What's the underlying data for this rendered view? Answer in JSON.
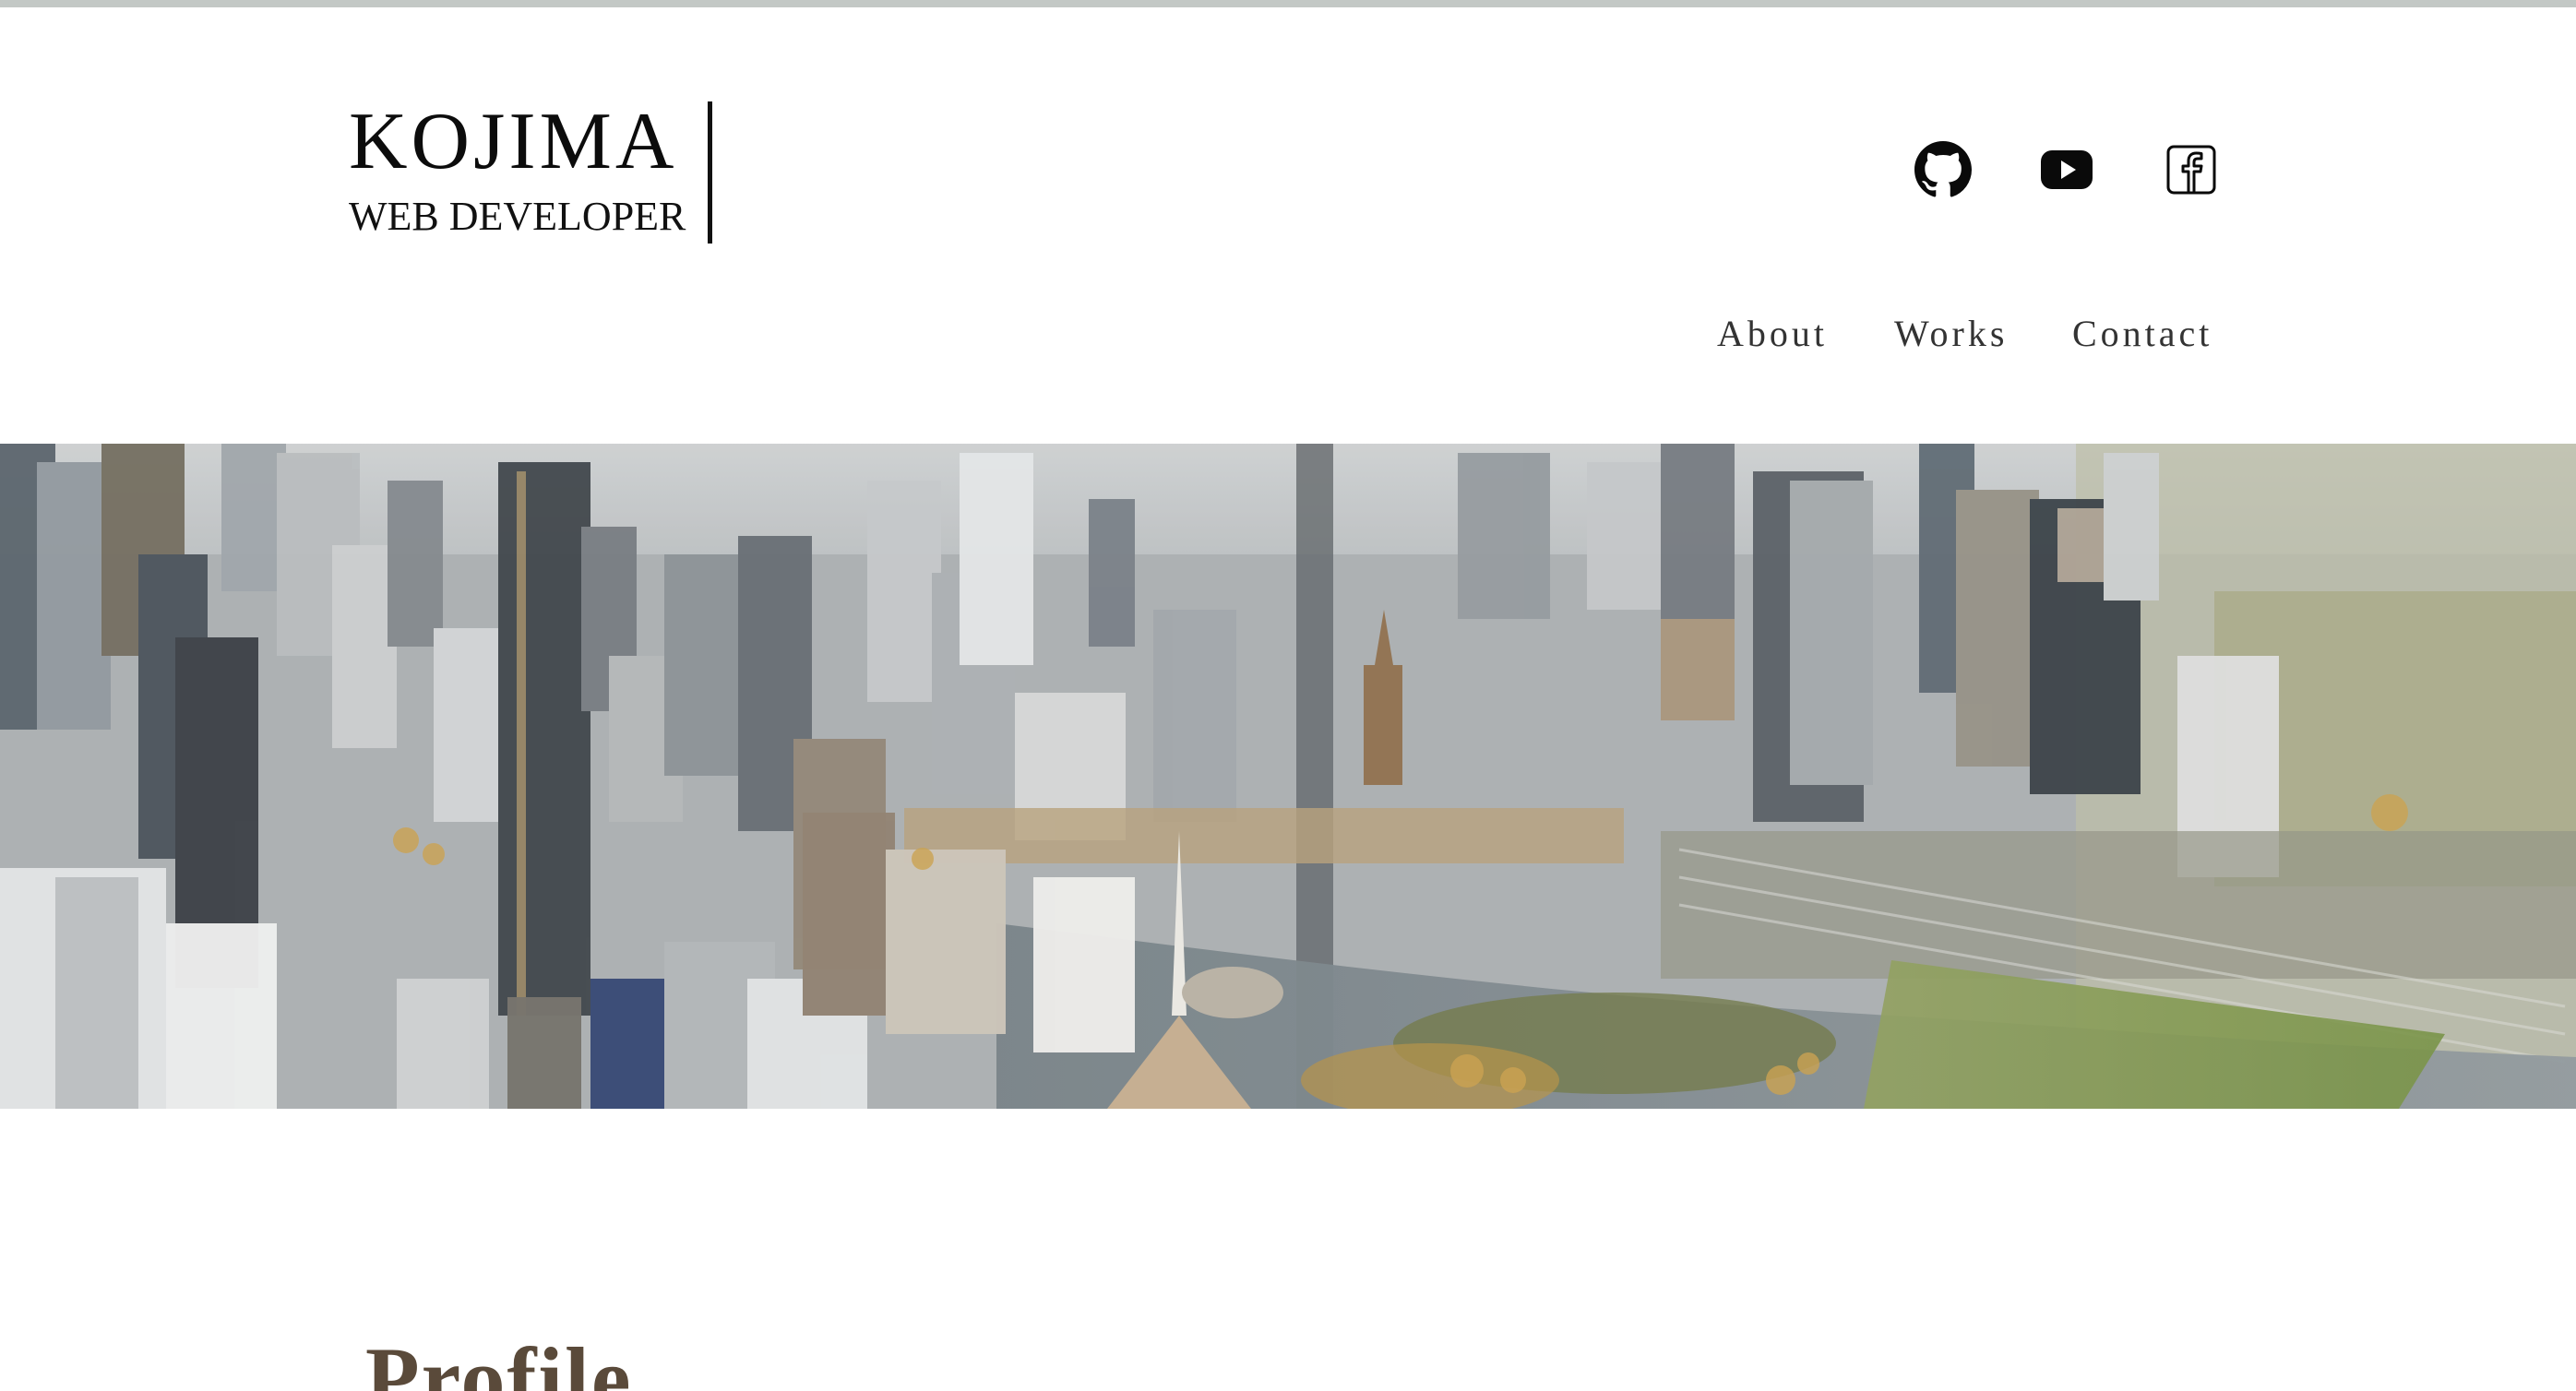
{
  "header": {
    "logo_name": "KOJIMA",
    "logo_subtitle": "WEB DEVELOPER"
  },
  "social": [
    {
      "name": "github",
      "icon": "github-icon"
    },
    {
      "name": "youtube",
      "icon": "youtube-icon"
    },
    {
      "name": "facebook",
      "icon": "facebook-icon"
    }
  ],
  "nav": {
    "items": [
      {
        "label": "About"
      },
      {
        "label": "Works"
      },
      {
        "label": "Contact"
      }
    ]
  },
  "hero": {
    "image": "city-aerial-photo"
  },
  "main": {
    "section_title": "Profile"
  },
  "colors": {
    "top_strip": "#c3c8c5",
    "text": "#111111",
    "nav_text": "#333333",
    "profile_heading": "#5a4a3a"
  }
}
